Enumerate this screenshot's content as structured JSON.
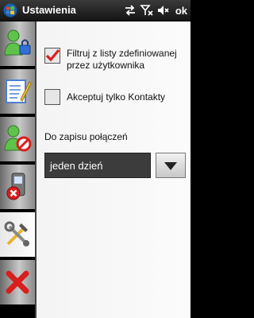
{
  "window": {
    "title": "Ustawienia",
    "ok_label": "ok"
  },
  "status_icons": [
    "sync-arrows-icon",
    "no-signal-icon",
    "speaker-muted-icon"
  ],
  "tabs": [
    {
      "icon": "user-lock-icon",
      "active": false
    },
    {
      "icon": "notepad-edit-icon",
      "active": false
    },
    {
      "icon": "user-blocked-icon",
      "active": false
    },
    {
      "icon": "phone-delete-icon",
      "active": false
    },
    {
      "icon": "tools-settings-icon",
      "active": true
    },
    {
      "icon": "close-x-icon",
      "active": false
    }
  ],
  "settings": {
    "filter_checkbox": {
      "label": "Filtruj z listy zdefiniowanej przez użytkownika",
      "checked": true
    },
    "contacts_checkbox": {
      "label": "Akceptuj tylko Kontakty",
      "checked": false
    },
    "save_section_label": "Do zapisu połączeń",
    "save_duration": {
      "selected": "jeden dzień"
    }
  },
  "colors": {
    "check": "#d81e1e",
    "accent_green": "#3cb43c",
    "accent_blue": "#2f6fd6"
  }
}
